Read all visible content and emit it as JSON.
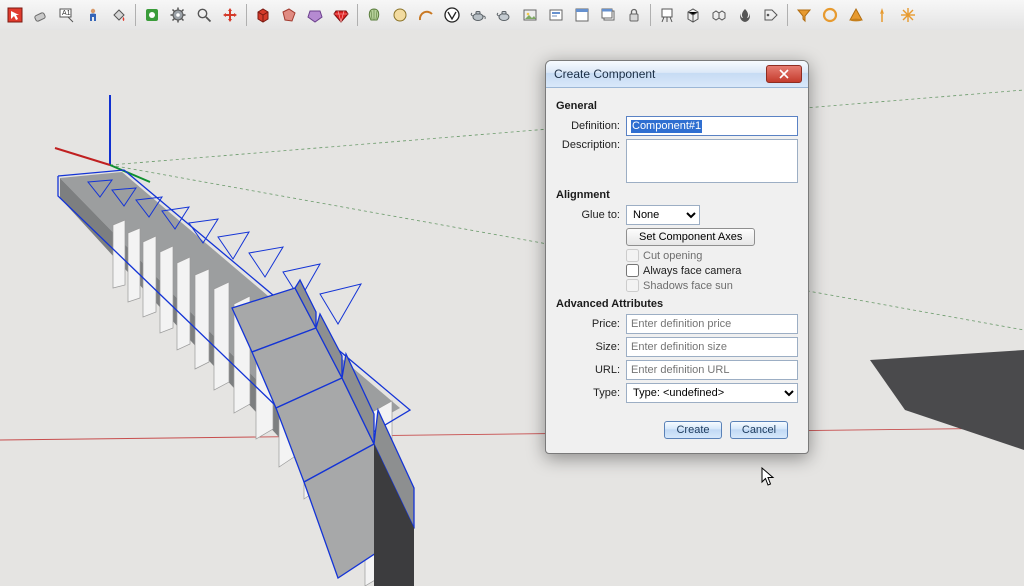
{
  "toolbar": {
    "groups": [
      [
        "select-red",
        "erase",
        "text-label",
        "person",
        "paint-bucket-red"
      ],
      [
        "plugin-green",
        "gear",
        "magnifier",
        "move-arrows"
      ],
      [
        "cube-red",
        "poly-red",
        "poly-purple",
        "ruby"
      ],
      [
        "shell-green",
        "circle",
        "arc",
        "vray-logo",
        "teapot",
        "teapot2",
        "picture",
        "slide",
        "window",
        "window-stack",
        "lock"
      ],
      [
        "easel",
        "box",
        "boxes",
        "flame",
        "tag"
      ],
      [
        "filter-orange",
        "ring-orange",
        "cone-orange",
        "compass-orange",
        "sparkle-orange"
      ]
    ]
  },
  "dialog": {
    "title": "Create Component",
    "sections": {
      "general": {
        "heading": "General",
        "definition_label": "Definition:",
        "definition_value": "Component#1",
        "description_label": "Description:",
        "description_value": ""
      },
      "alignment": {
        "heading": "Alignment",
        "glue_label": "Glue to:",
        "glue_value": "None",
        "set_axes_btn": "Set Component Axes",
        "cut_opening": "Cut opening",
        "always_face_camera": "Always face camera",
        "shadows_face_sun": "Shadows face sun"
      },
      "advanced": {
        "heading": "Advanced Attributes",
        "price_label": "Price:",
        "price_placeholder": "Enter definition price",
        "size_label": "Size:",
        "size_placeholder": "Enter definition size",
        "url_label": "URL:",
        "url_placeholder": "Enter definition URL",
        "type_label": "Type:",
        "type_value": "Type: <undefined>"
      }
    },
    "buttons": {
      "create": "Create",
      "cancel": "Cancel"
    }
  }
}
